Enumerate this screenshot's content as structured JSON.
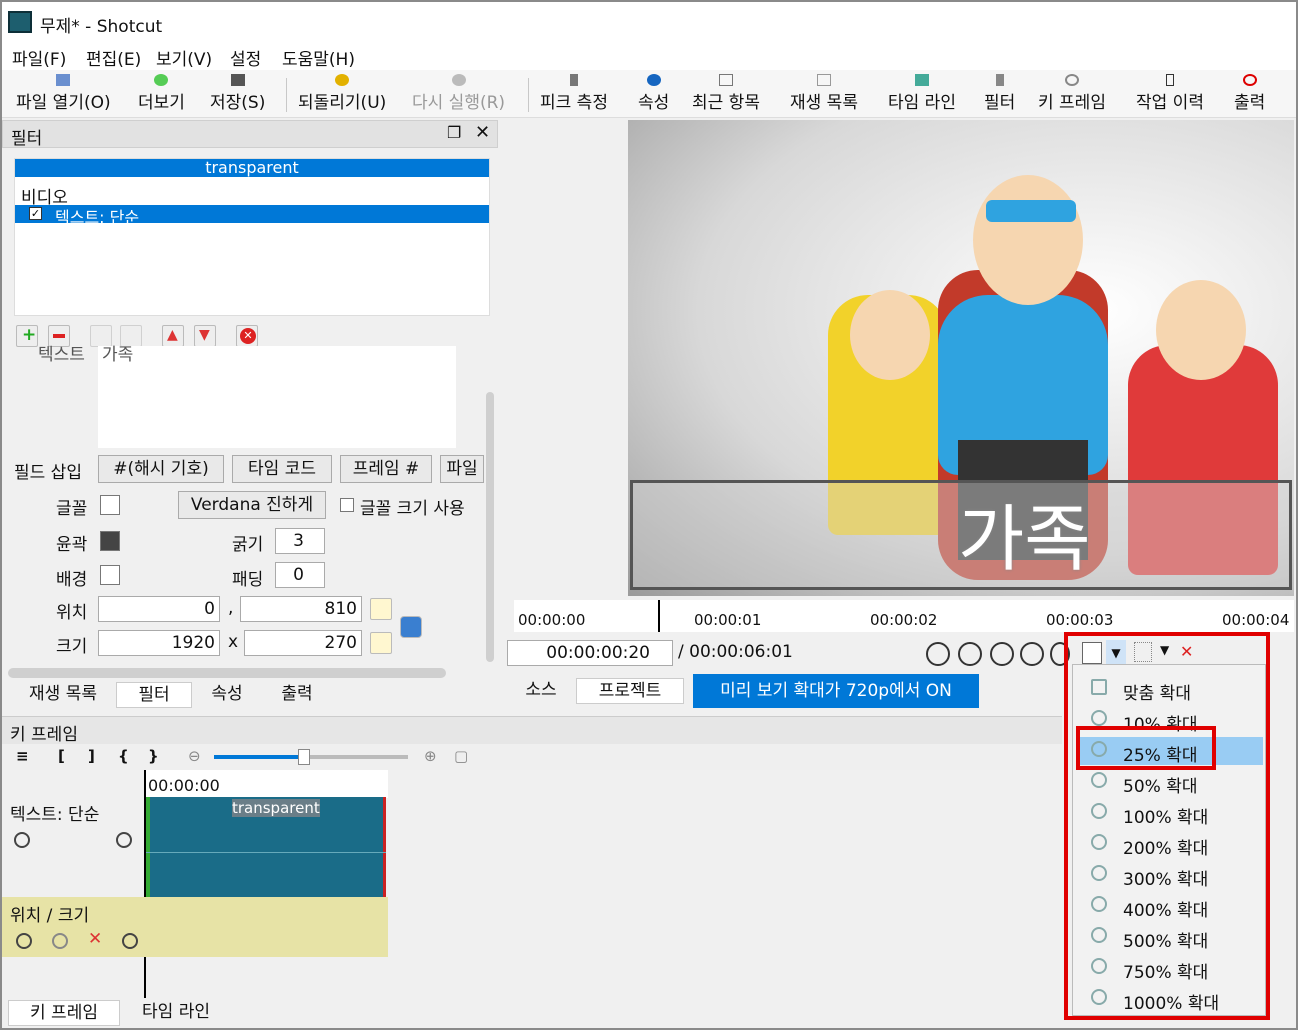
{
  "window": {
    "title": "무제* - Shotcut"
  },
  "menubar": [
    "파일(F)",
    "편집(E)",
    "보기(V)",
    "설정",
    "도움말(H)"
  ],
  "toolbar": {
    "open": "파일 열기(O)",
    "more": "더보기",
    "save": "저장(S)",
    "undo": "되돌리기(U)",
    "redo": "다시 실행(R)",
    "peak": "피크 측정",
    "props": "속성",
    "recent": "최근 항목",
    "playlist": "재생 목록",
    "timeline": "타임 라인",
    "filter": "필터",
    "keyframe": "키 프레임",
    "history": "작업 이력",
    "export": "출력"
  },
  "filters_panel": {
    "title": "필터",
    "clip": "transparent",
    "group": "비디오",
    "item": "텍스트: 단순",
    "text_label": "텍스트",
    "text_value": "가족",
    "insert_field": "필드 삽입",
    "insert_buttons": [
      "#(해시 기호)",
      "타임 코드",
      "프레임 #",
      "파일"
    ],
    "font_label": "글꼴",
    "font_button": "Verdana 진하게",
    "font_size_check": "글꼴 크기 사용",
    "outline_label": "윤곽",
    "thickness_label": "굵기",
    "thickness": "3",
    "bg_label": "배경",
    "padding_label": "패딩",
    "padding": "0",
    "pos_label": "위치",
    "pos_x": "0",
    "pos_sep": ",",
    "pos_y": "810",
    "size_label": "크기",
    "size_w": "1920",
    "size_sep": "x",
    "size_h": "270",
    "colors": {
      "outline": "#444444",
      "selected": "#0078d7"
    }
  },
  "left_tabs": [
    "재생 목록",
    "필터",
    "속성",
    "출력"
  ],
  "preview": {
    "overlay_text": "가족"
  },
  "ruler": [
    "00:00:00",
    "00:00:01",
    "00:00:02",
    "00:00:03",
    "00:00:04"
  ],
  "transport": {
    "current": "00:00:00:20",
    "total": "/ 00:00:06:01"
  },
  "source_tabs": [
    "소스",
    "프로젝트"
  ],
  "zoom_notice": "미리 보기 확대가 720p에서 ON",
  "keyframe_panel": {
    "title": "키 프레임",
    "timecode": "00:00:00",
    "track_name": "텍스트: 단순",
    "clip_name": "transparent",
    "param": "위치 / 크기"
  },
  "bottom_tabs": [
    "키 프레임",
    "타임 라인"
  ],
  "zoom_menu": {
    "items": [
      "맞춤 확대",
      "10% 확대",
      "25% 확대",
      "50% 확대",
      "100% 확대",
      "200% 확대",
      "300% 확대",
      "400% 확대",
      "500% 확대",
      "750% 확대",
      "1000% 확대"
    ],
    "highlighted": "25% 확대"
  }
}
